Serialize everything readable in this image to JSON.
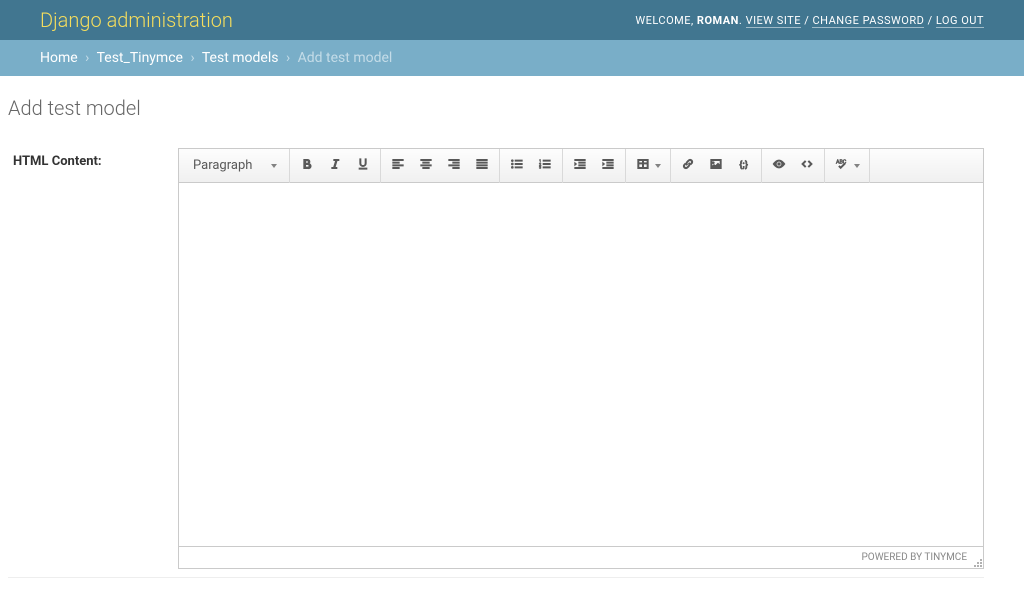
{
  "header": {
    "branding": "Django administration",
    "welcome": "WELCOME, ",
    "username": "ROMAN",
    "period": ". ",
    "view_site": "VIEW SITE",
    "change_password": "CHANGE PASSWORD",
    "logout": "LOG OUT",
    "sep": " / "
  },
  "breadcrumbs": {
    "home": "Home",
    "app": "Test_Tinymce",
    "model": "Test models",
    "current": "Add test model",
    "sep": "›"
  },
  "page": {
    "title": "Add test model"
  },
  "form": {
    "html_content_label": "HTML Content:"
  },
  "editor": {
    "format_label": "Paragraph",
    "powered_by": "POWERED BY TINYMCE"
  }
}
